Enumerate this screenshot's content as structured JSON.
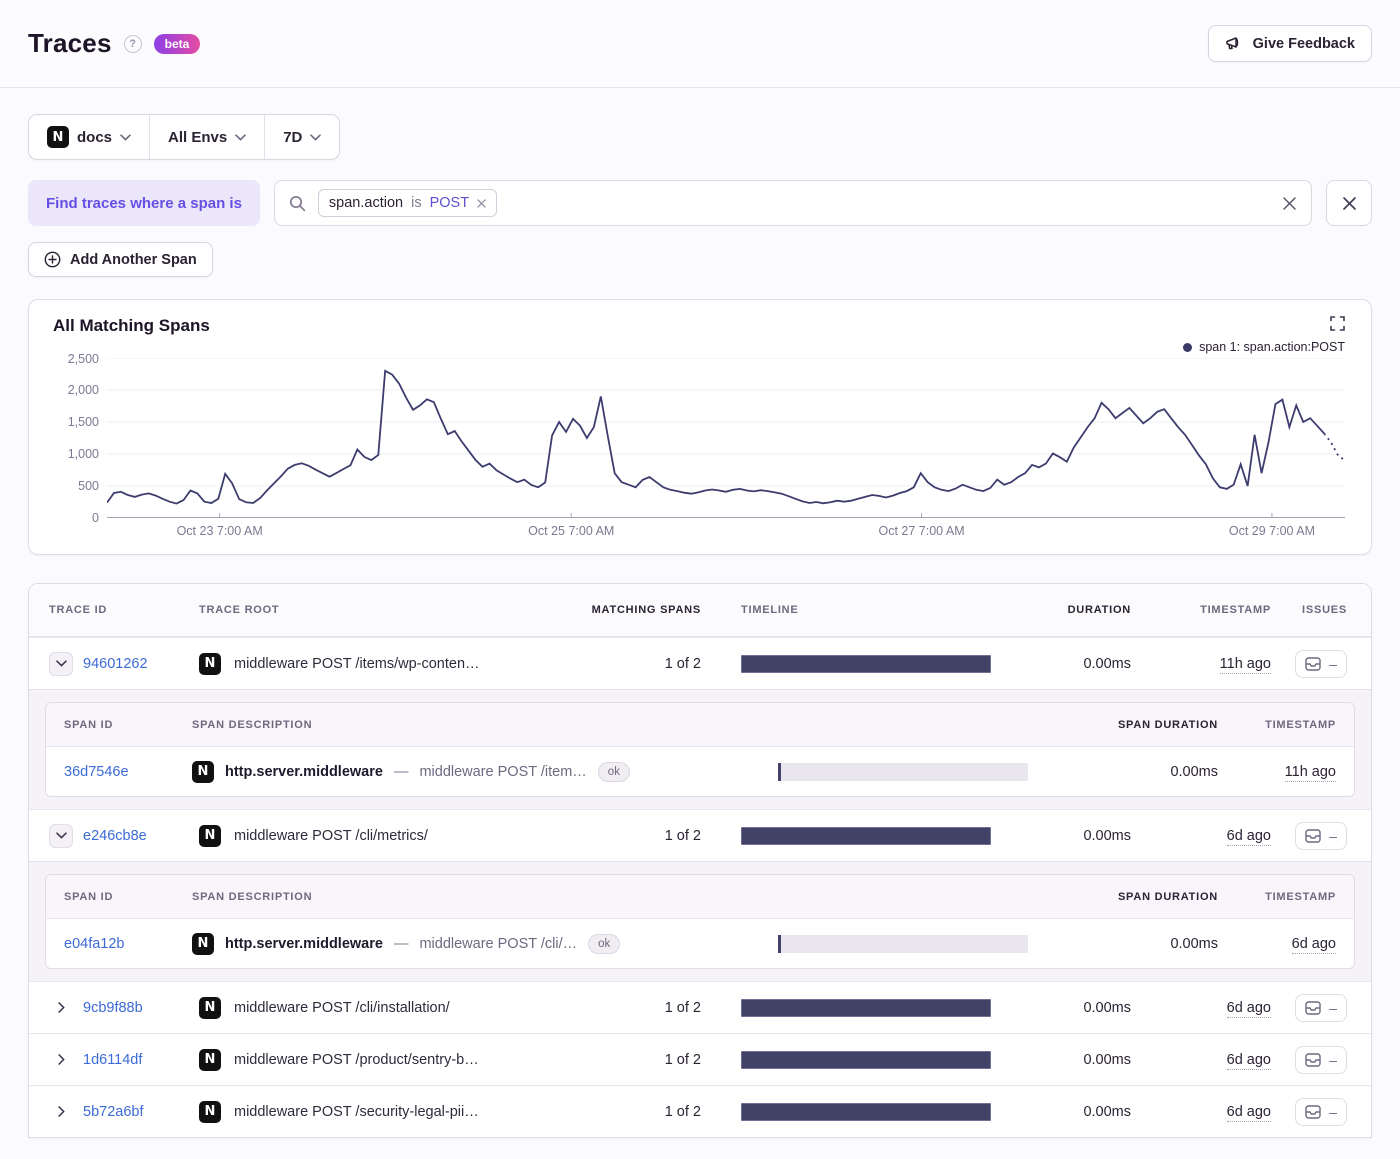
{
  "header": {
    "title": "Traces",
    "help_icon": "?",
    "beta_label": "beta",
    "feedback_label": "Give Feedback"
  },
  "filters": {
    "project": "docs",
    "project_badge_letter": "N",
    "environment": "All Envs",
    "period": "7D"
  },
  "span_query": {
    "where_label": "Find traces where a span is",
    "token": {
      "key": "span.action",
      "op": "is",
      "value": "POST"
    },
    "add_span_label": "Add Another Span"
  },
  "chart": {
    "title": "All Matching Spans",
    "legend": "span 1: span.action:POST"
  },
  "chart_data": {
    "type": "line",
    "title": "All Matching Spans",
    "series_name": "span 1: span.action:POST",
    "ylim": [
      0,
      2500
    ],
    "grid": true,
    "legend_position": "top-right",
    "line_color": "#3d3c6e",
    "yticks": [
      {
        "v": 0,
        "label": "0"
      },
      {
        "v": 500,
        "label": "500"
      },
      {
        "v": 1000,
        "label": "1,000"
      },
      {
        "v": 1500,
        "label": "1,500"
      },
      {
        "v": 2000,
        "label": "2,000"
      },
      {
        "v": 2500,
        "label": "2,500"
      }
    ],
    "x_ticks": [
      {
        "label": "Oct 23 7:00 AM",
        "pos": 0.091
      },
      {
        "label": "Oct 25 7:00 AM",
        "pos": 0.375
      },
      {
        "label": "Oct 27 7:00 AM",
        "pos": 0.658
      },
      {
        "label": "Oct 29 7:00 AM",
        "pos": 0.941
      }
    ],
    "dashed_tail_points": 4,
    "values": [
      240,
      390,
      410,
      360,
      330,
      365,
      385,
      350,
      300,
      255,
      225,
      280,
      430,
      385,
      255,
      235,
      300,
      690,
      540,
      295,
      245,
      235,
      310,
      430,
      540,
      650,
      770,
      830,
      855,
      815,
      755,
      700,
      645,
      705,
      765,
      825,
      1070,
      955,
      905,
      985,
      2300,
      2240,
      2100,
      1880,
      1690,
      1760,
      1855,
      1810,
      1550,
      1310,
      1360,
      1195,
      1050,
      905,
      800,
      850,
      745,
      680,
      615,
      560,
      600,
      515,
      480,
      555,
      1290,
      1500,
      1345,
      1550,
      1445,
      1250,
      1420,
      1900,
      1280,
      700,
      560,
      520,
      480,
      595,
      640,
      560,
      480,
      440,
      420,
      395,
      380,
      400,
      430,
      445,
      430,
      410,
      440,
      455,
      430,
      415,
      435,
      420,
      400,
      380,
      340,
      300,
      260,
      235,
      250,
      230,
      245,
      270,
      255,
      270,
      300,
      330,
      360,
      345,
      320,
      350,
      390,
      420,
      480,
      700,
      560,
      480,
      440,
      420,
      460,
      520,
      480,
      440,
      420,
      470,
      600,
      520,
      560,
      640,
      700,
      830,
      790,
      850,
      1010,
      950,
      880,
      1100,
      1260,
      1420,
      1560,
      1800,
      1700,
      1560,
      1640,
      1720,
      1600,
      1480,
      1560,
      1660,
      1700,
      1560,
      1420,
      1300,
      1140,
      980,
      840,
      620,
      480,
      455,
      520,
      840,
      500,
      1300,
      700,
      1180,
      1780,
      1850,
      1420,
      1760,
      1500,
      1560,
      1440,
      1320,
      1180,
      980,
      900
    ]
  },
  "table": {
    "columns": [
      "TRACE ID",
      "TRACE ROOT",
      "MATCHING SPANS",
      "TIMELINE",
      "DURATION",
      "TIMESTAMP",
      "ISSUES"
    ],
    "sub_columns": [
      "SPAN ID",
      "SPAN DESCRIPTION",
      "SPAN DURATION",
      "TIMESTAMP"
    ],
    "issues_empty": "–",
    "desc_separator": "—",
    "rows": [
      {
        "id": "94601262",
        "root": "middleware POST /items/wp-conten…",
        "matching": "1 of 2",
        "duration": "0.00ms",
        "timestamp": "11h ago",
        "spans": [
          {
            "id": "36d7546e",
            "op": "http.server.middleware",
            "desc": "middleware POST /item…",
            "status": "ok",
            "duration": "0.00ms",
            "timestamp": "11h ago"
          }
        ]
      },
      {
        "id": "e246cb8e",
        "root": "middleware POST /cli/metrics/",
        "matching": "1 of 2",
        "duration": "0.00ms",
        "timestamp": "6d ago",
        "spans": [
          {
            "id": "e04fa12b",
            "op": "http.server.middleware",
            "desc": "middleware POST /cli/…",
            "status": "ok",
            "duration": "0.00ms",
            "timestamp": "6d ago"
          }
        ]
      },
      {
        "id": "9cb9f88b",
        "root": "middleware POST /cli/installation/",
        "matching": "1 of 2",
        "duration": "0.00ms",
        "timestamp": "6d ago"
      },
      {
        "id": "1d6114df",
        "root": "middleware POST /product/sentry-b…",
        "matching": "1 of 2",
        "duration": "0.00ms",
        "timestamp": "6d ago"
      },
      {
        "id": "5b72a6bf",
        "root": "middleware POST /security-legal-pii…",
        "matching": "1 of 2",
        "duration": "0.00ms",
        "timestamp": "6d ago"
      }
    ]
  },
  "colors": {
    "accent_purple": "#6450e3",
    "link_blue": "#3c6ad6",
    "chart_line": "#3d3c6e",
    "timeline_bar": "#414266",
    "beta_gradient": [
      "#8b3fe8",
      "#e54ca2"
    ],
    "panel_border": "#e0dbe7",
    "background": "#fbfafc"
  }
}
